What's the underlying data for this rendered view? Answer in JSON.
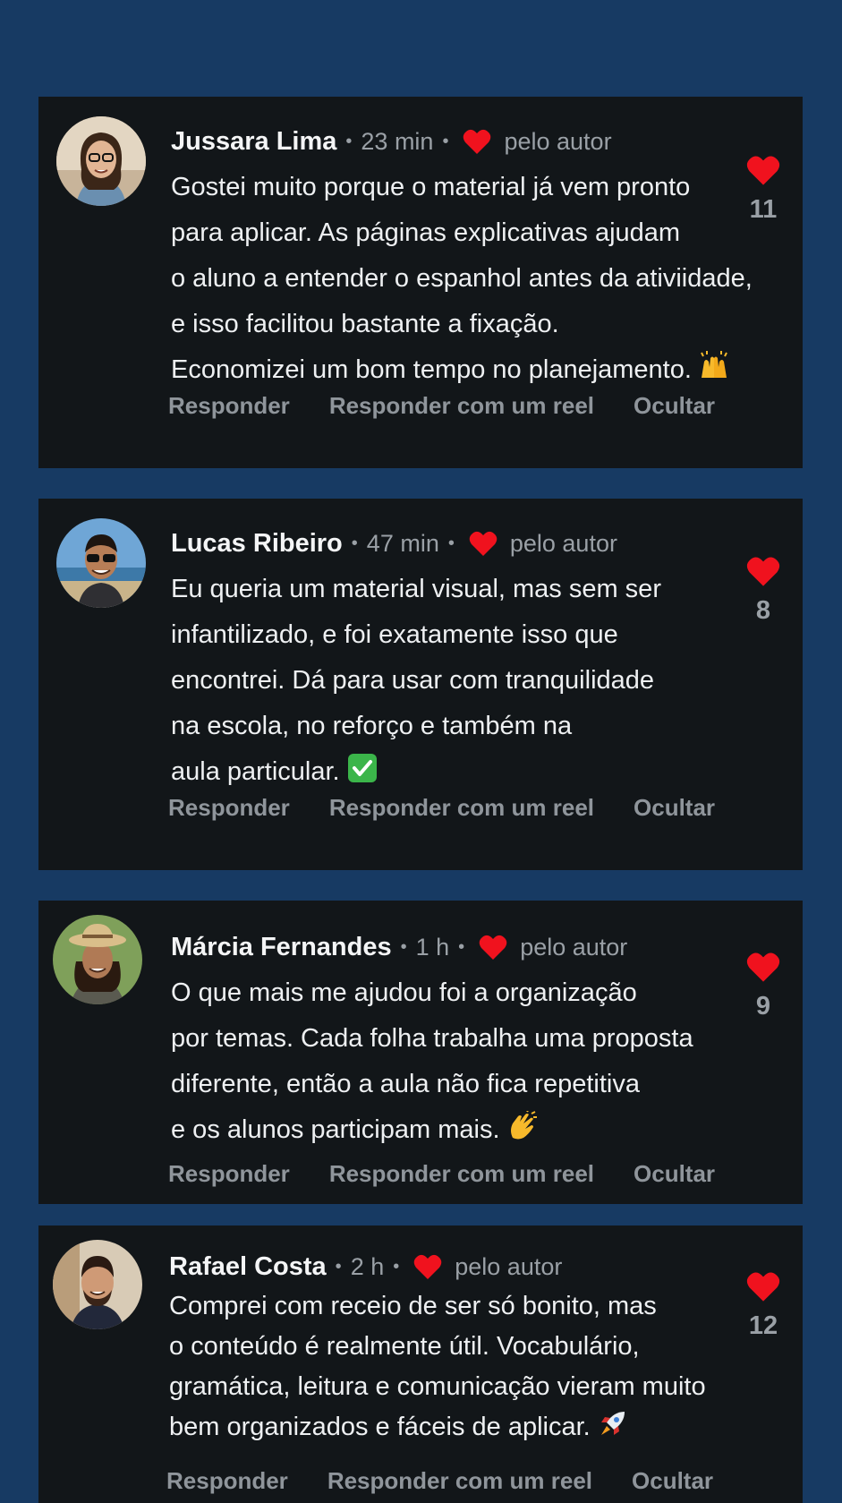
{
  "comments": [
    {
      "name": "Jussara Lima",
      "time": "23 min",
      "by_author": "pelo autor",
      "lines": [
        "Gostei muito porque o material já vem pronto",
        "para aplicar. As páginas explicativas ajudam",
        "o aluno a entender o espanhol antes da ativiidade,",
        "e isso facilitou bastante a fixação.",
        "Economizei um bom tempo no planejamento."
      ],
      "emoji": "raising-hands-icon",
      "likes": "11",
      "actions": [
        "Responder",
        "Responder com um reel",
        "Ocultar"
      ]
    },
    {
      "name": "Lucas Ribeiro",
      "time": "47 min",
      "by_author": "pelo autor",
      "lines": [
        "Eu queria um material visual, mas sem ser",
        "infantilizado, e foi exatamente isso que",
        "encontrei. Dá para usar com tranquilidade",
        "na escola, no reforço e também na",
        "aula particular."
      ],
      "emoji": "check-mark-icon",
      "likes": "8",
      "actions": [
        "Responder",
        "Responder com um reel",
        "Ocultar"
      ]
    },
    {
      "name": "Márcia Fernandes",
      "time": "1 h",
      "by_author": "pelo autor",
      "lines": [
        "O que mais me ajudou foi a organização",
        "por temas. Cada folha trabalha uma proposta",
        "diferente, então a aula não fica repetitiva",
        "e os alunos participam mais."
      ],
      "emoji": "clapping-hands-icon",
      "likes": "9",
      "actions": [
        "Responder",
        "Responder com um reel",
        "Ocultar"
      ]
    },
    {
      "name": "Rafael Costa",
      "time": "2 h",
      "by_author": "pelo autor",
      "lines": [
        "Comprei com receio de ser só bonito, mas",
        "o conteúdo é realmente útil. Vocabulário,",
        "gramática, leitura e comunicação vieram muito",
        "bem organizados e fáceis de aplicar."
      ],
      "emoji": "rocket-icon",
      "likes": "12",
      "actions": [
        "Responder",
        "Responder com um reel",
        "Ocultar"
      ]
    }
  ],
  "colors": {
    "background": "#173a63",
    "card": "#121619",
    "heart": "#f0121e",
    "muted": "#9aa0a6"
  }
}
